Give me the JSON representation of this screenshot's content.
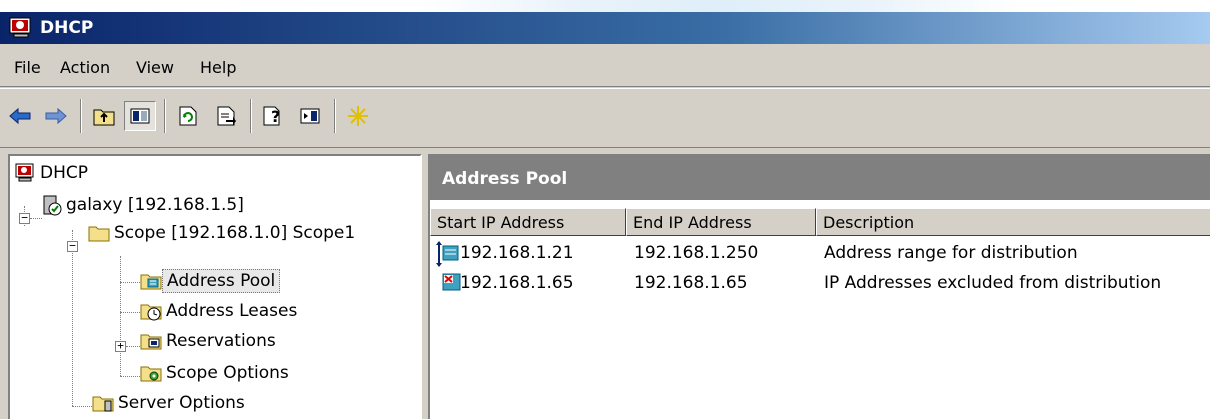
{
  "window": {
    "title": "DHCP"
  },
  "menu": {
    "items": [
      "File",
      "Action",
      "View",
      "Help"
    ]
  },
  "toolbar": {
    "buttons": [
      "back-icon",
      "forward-icon",
      "up-folder-icon",
      "show-hide-tree-icon",
      "refresh-icon",
      "export-list-icon",
      "help-icon",
      "properties-icon",
      "add-server-icon"
    ]
  },
  "tree": {
    "root": "DHCP",
    "server": "galaxy [192.168.1.5]",
    "scope": "Scope [192.168.1.0] Scope1",
    "scope_children": [
      "Address Pool",
      "Address Leases",
      "Reservations",
      "Scope Options"
    ],
    "server_options": "Server Options",
    "selected": "Address Pool"
  },
  "pane": {
    "title": "Address Pool",
    "columns": [
      "Start IP Address",
      "End IP Address",
      "Description"
    ],
    "rows": [
      {
        "start": "192.168.1.21",
        "end": "192.168.1.250",
        "description": "Address range for distribution",
        "icon": "address-range-icon"
      },
      {
        "start": "192.168.1.65",
        "end": "192.168.1.65",
        "description": "IP Addresses excluded from distribution",
        "icon": "exclusion-range-icon"
      }
    ]
  },
  "colors": {
    "title_bar": "#0a246a",
    "pane_header": "#808080",
    "chrome": "#d4d0c8"
  }
}
